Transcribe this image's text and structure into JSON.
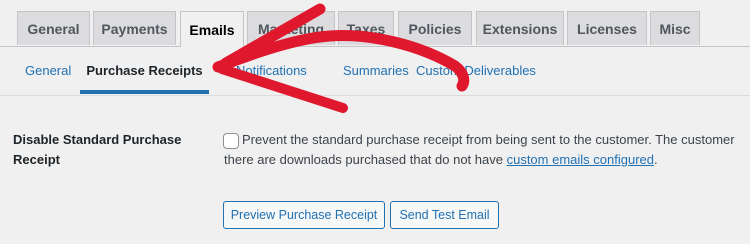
{
  "tabs": [
    {
      "label": "General"
    },
    {
      "label": "Payments"
    },
    {
      "label": "Emails",
      "active": true
    },
    {
      "label": "Marketing"
    },
    {
      "label": "Taxes"
    },
    {
      "label": "Policies"
    },
    {
      "label": "Extensions"
    },
    {
      "label": "Licenses"
    },
    {
      "label": "Misc"
    }
  ],
  "subnav": [
    {
      "label": "General"
    },
    {
      "label": "Purchase Receipts",
      "active": true
    },
    {
      "label": "Notifications"
    },
    {
      "label": "Summaries"
    },
    {
      "label": "Custom Deliverables"
    }
  ],
  "setting": {
    "label": "Disable Standard Purchase Receipt",
    "checked": false,
    "description_line1": "Prevent the standard purchase receipt from being sent to the customer. The customer",
    "description_line2_prefix": "there are downloads purchased that do not have ",
    "description_link": "custom emails configured",
    "description_suffix": "."
  },
  "buttons": {
    "preview": "Preview Purchase Receipt",
    "send_test": "Send Test Email"
  },
  "annotation": {
    "type": "red-arrow",
    "color": "#e0182d"
  }
}
